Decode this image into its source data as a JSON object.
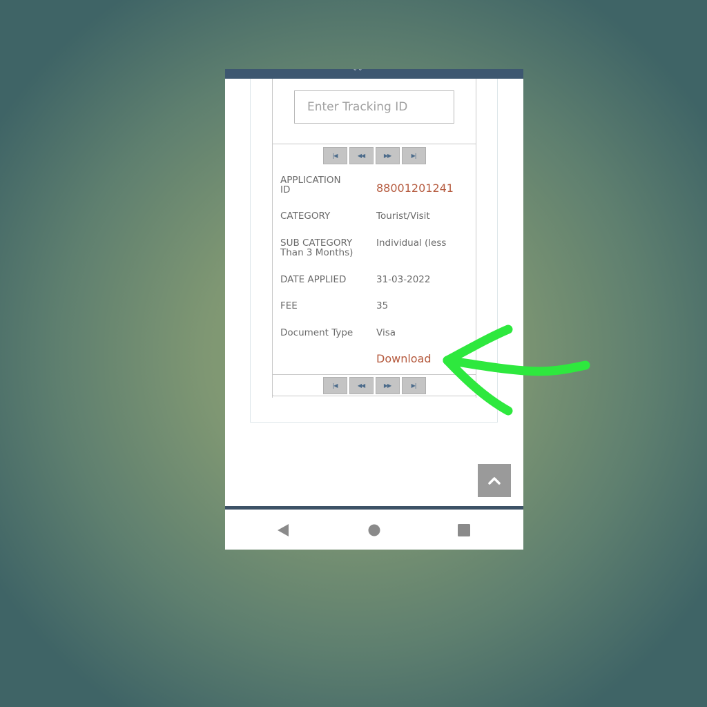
{
  "search": {
    "placeholder": "Enter Tracking ID",
    "value": ""
  },
  "pager": {
    "first_icon": "first-page-icon",
    "prev_icon": "prev-page-icon",
    "next_icon": "next-page-icon",
    "last_icon": "last-page-icon",
    "first_glyph": "|◀",
    "prev_glyph": "◀◀",
    "next_glyph": "▶▶",
    "last_glyph": "▶|"
  },
  "details": [
    {
      "label": "APPLICATION ID",
      "value": "88001201241",
      "accent": true
    },
    {
      "label": "CATEGORY",
      "value": "Tourist/Visit"
    },
    {
      "label": "SUB CATEGORY Than 3 Months)",
      "value": "Individual (less"
    },
    {
      "label": "DATE APPLIED",
      "value": "31-03-2022"
    },
    {
      "label": "FEE",
      "value": "35"
    },
    {
      "label": "Document Type",
      "value": "Visa"
    }
  ],
  "download_label": "Download",
  "colors": {
    "accent": "#b55a3e",
    "header_bar": "#3d5770",
    "annotation_arrow": "#2ee83e"
  },
  "annotation": {
    "type": "arrow",
    "points_to": "Download"
  }
}
